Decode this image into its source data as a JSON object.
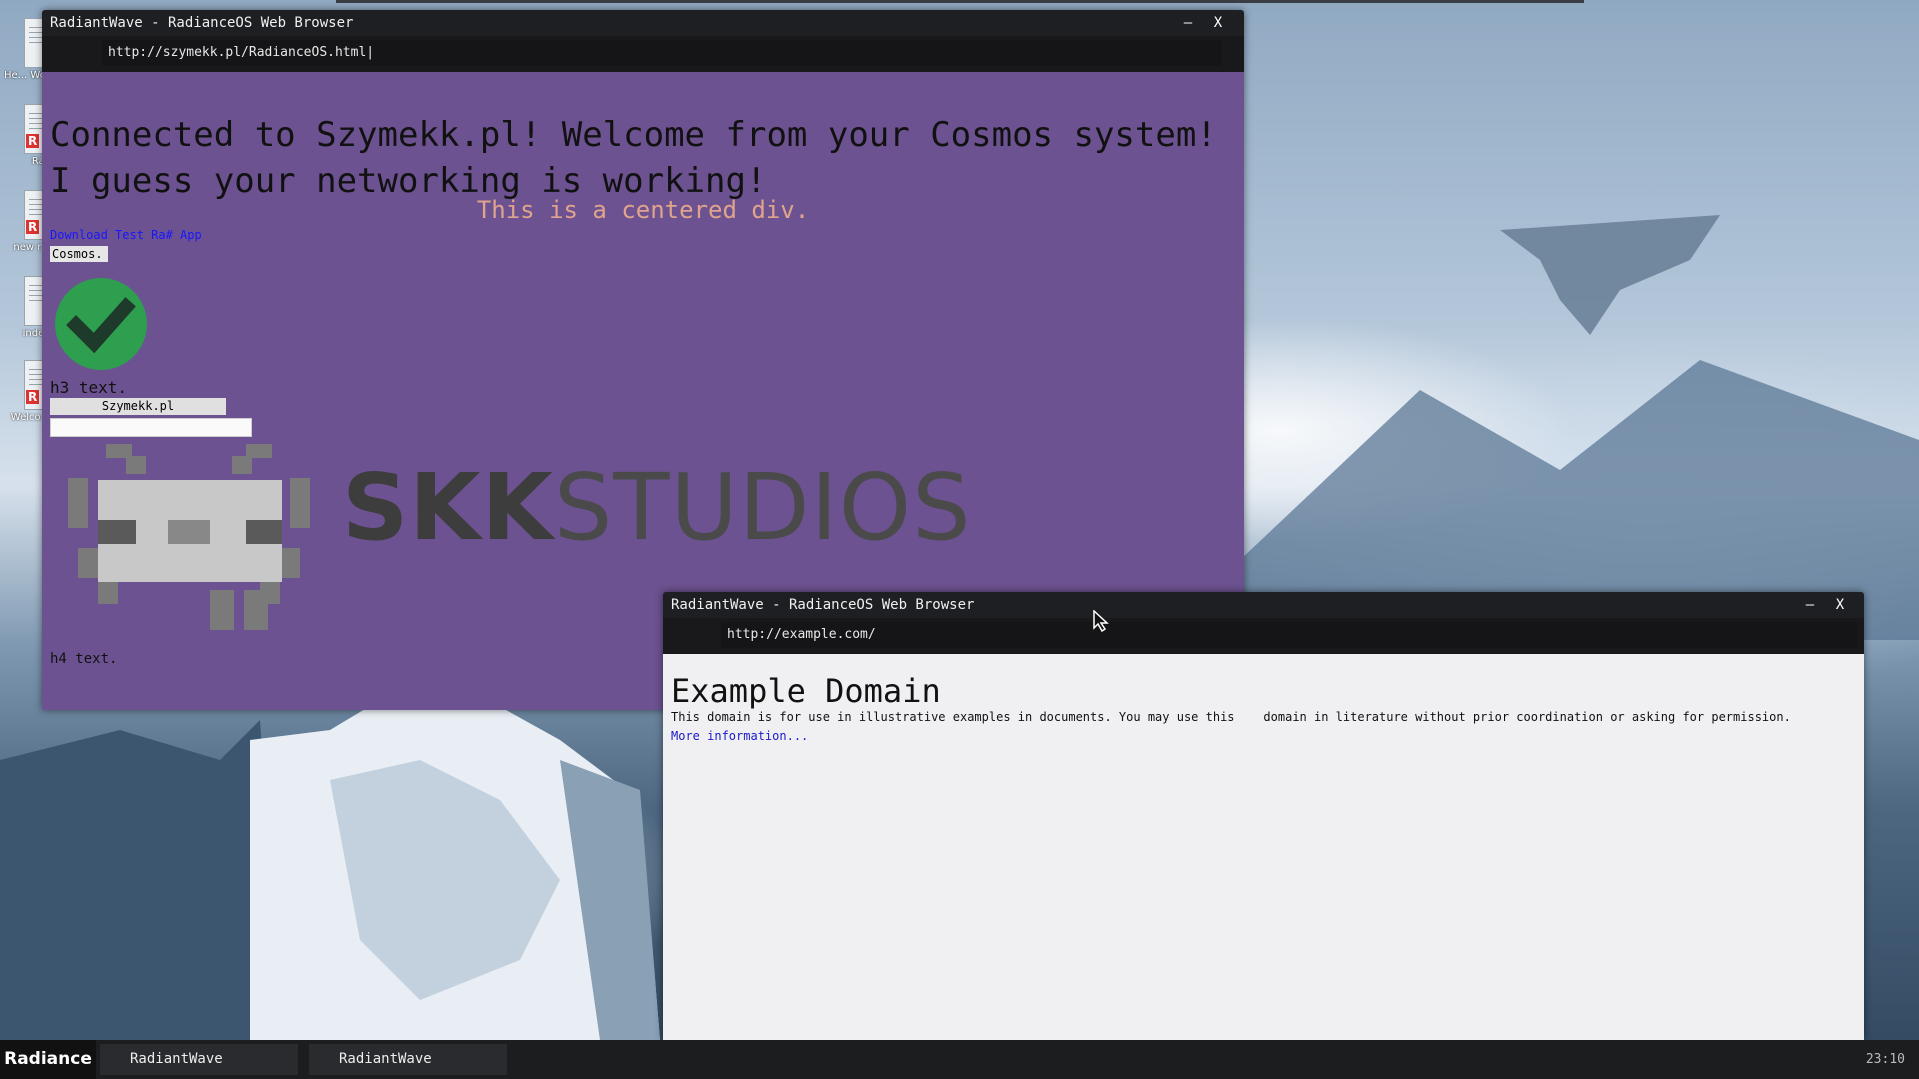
{
  "desktop": {
    "icons": [
      {
        "label": "He... World",
        "icon": "text-file-icon"
      },
      {
        "label": "Ras",
        "icon": "ra-app-icon"
      },
      {
        "label": "new r...",
        "icon": "ra-app-icon"
      },
      {
        "label": "index",
        "icon": "html-file-icon"
      },
      {
        "label": "Welco...",
        "icon": "ra-app-icon"
      }
    ]
  },
  "window1": {
    "title": "RadiantWave - RadianceOS Web Browser",
    "minimize": "–",
    "close": "X",
    "url": "http://szymekk.pl/RadianceOS.html|",
    "page": {
      "heading_line1": "Connected to Szymekk.pl! Welcome from your Cosmos system!",
      "heading_line2": "I guess your networking is working!",
      "centered_div": "This is a centered div.",
      "download_link": "Download Test Ra# App",
      "cosmos_button": "Cosmos.",
      "h3": "h3 text.",
      "szymekk_button": "Szymekk.pl",
      "input_value": "",
      "logo_bold": "SKK",
      "logo_light": "STUDIOS",
      "h4": "h4 text."
    },
    "colors": {
      "page_bg": "#6c5290",
      "centered_text": "#e0a48c",
      "link": "#1717ff"
    }
  },
  "window2": {
    "title": "RadiantWave - RadianceOS Web Browser",
    "minimize": "–",
    "close": "X",
    "url": "http://example.com/",
    "page": {
      "heading": "Example Domain",
      "paragraph": "This domain is for use in illustrative examples in documents. You may use this    domain in literature without prior coordination or asking for permission.",
      "more_link": "More information..."
    }
  },
  "taskbar": {
    "start_label": "Radiance",
    "items": [
      {
        "label": "RadiantWave"
      },
      {
        "label": "RadiantWave"
      }
    ],
    "clock": "23:10"
  }
}
